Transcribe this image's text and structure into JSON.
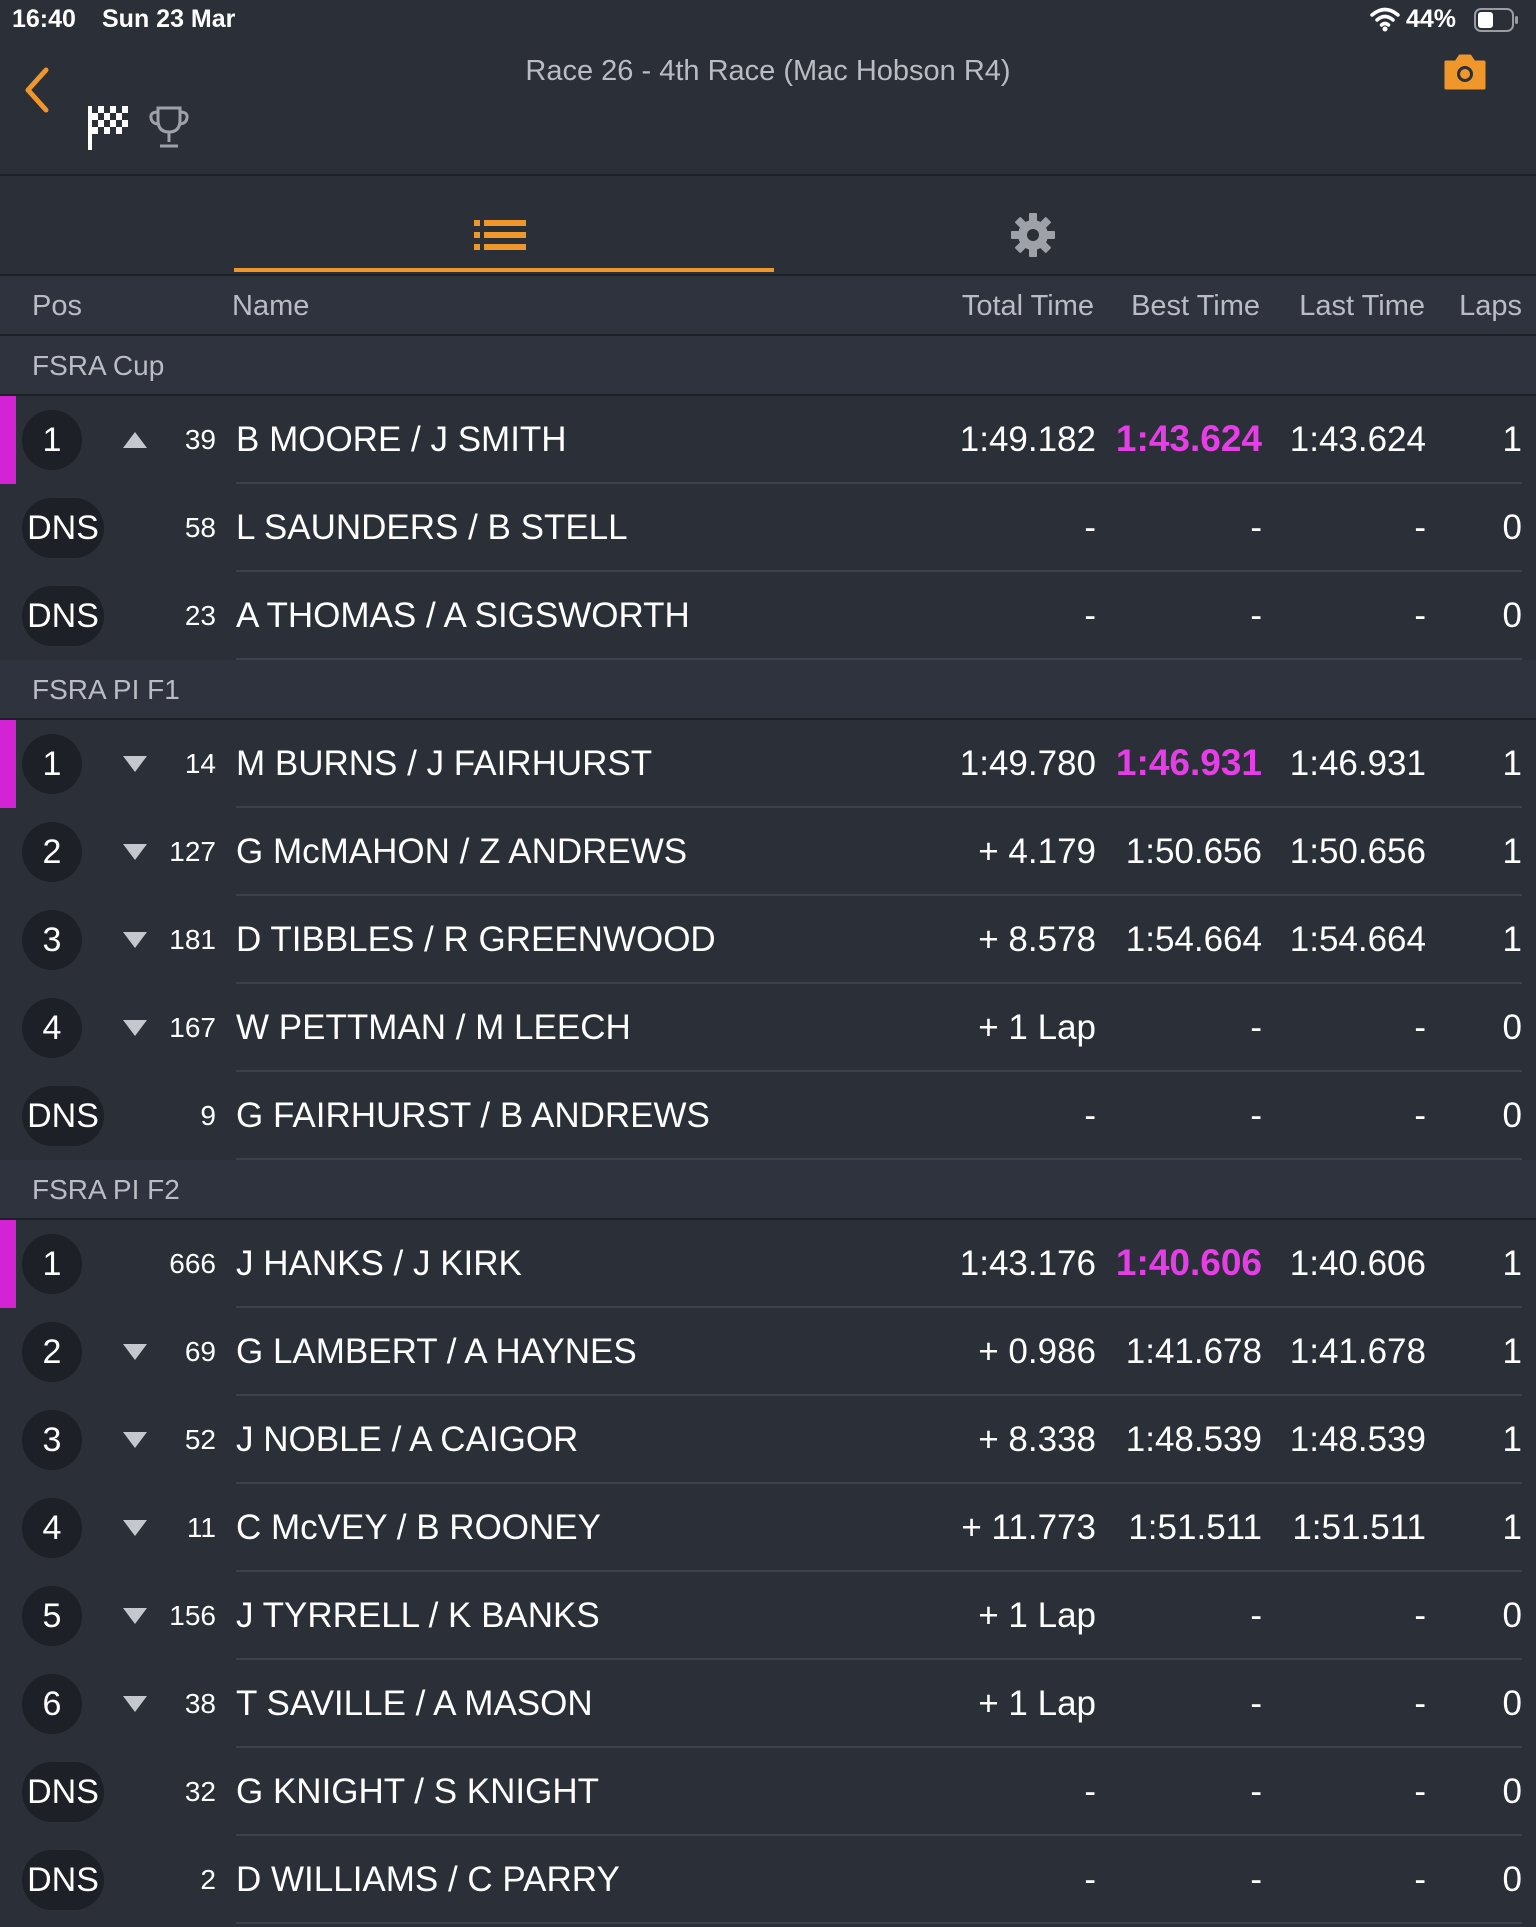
{
  "status_bar": {
    "time": "16:40",
    "date": "Sun 23 Mar",
    "battery": "44%"
  },
  "nav": {
    "title": "Race 26 - 4th Race (Mac Hobson R4)"
  },
  "colors": {
    "accent": "#f0972b",
    "fastest": "#e63ee6",
    "leader": "#d423d4",
    "background": "#2b2f38"
  },
  "icons": [
    "back-chevron-icon",
    "checkered-flag-icon",
    "trophy-icon",
    "camera-icon",
    "list-icon",
    "gear-icon",
    "wifi-icon",
    "battery-icon"
  ],
  "columns": {
    "pos": "Pos",
    "name": "Name",
    "total": "Total Time",
    "best": "Best Time",
    "last": "Last Time",
    "laps": "Laps"
  },
  "sections": [
    {
      "title": "FSRA Cup",
      "rows": [
        {
          "pos": "1",
          "trend": "up",
          "num": "39",
          "name": "B MOORE / J SMITH",
          "total": "1:49.182",
          "best": "1:43.624",
          "best_fastest": true,
          "last": "1:43.624",
          "laps": "1",
          "leader": true
        },
        {
          "pos": "DNS",
          "trend": "",
          "num": "58",
          "name": "L SAUNDERS / B STELL",
          "total": "-",
          "best": "-",
          "last": "-",
          "laps": "0"
        },
        {
          "pos": "DNS",
          "trend": "",
          "num": "23",
          "name": "A THOMAS / A SIGSWORTH",
          "total": "-",
          "best": "-",
          "last": "-",
          "laps": "0"
        }
      ]
    },
    {
      "title": "FSRA PI F1",
      "rows": [
        {
          "pos": "1",
          "trend": "down",
          "num": "14",
          "name": "M BURNS / J FAIRHURST",
          "total": "1:49.780",
          "best": "1:46.931",
          "best_fastest": true,
          "last": "1:46.931",
          "laps": "1",
          "leader": true
        },
        {
          "pos": "2",
          "trend": "down",
          "num": "127",
          "name": "G McMAHON / Z ANDREWS",
          "total": "+ 4.179",
          "best": "1:50.656",
          "last": "1:50.656",
          "laps": "1"
        },
        {
          "pos": "3",
          "trend": "down",
          "num": "181",
          "name": "D TIBBLES / R GREENWOOD",
          "total": "+ 8.578",
          "best": "1:54.664",
          "last": "1:54.664",
          "laps": "1"
        },
        {
          "pos": "4",
          "trend": "down",
          "num": "167",
          "name": "W PETTMAN / M LEECH",
          "total": "+ 1 Lap",
          "best": "-",
          "last": "-",
          "laps": "0"
        },
        {
          "pos": "DNS",
          "trend": "",
          "num": "9",
          "name": "G FAIRHURST / B ANDREWS",
          "total": "-",
          "best": "-",
          "last": "-",
          "laps": "0"
        }
      ]
    },
    {
      "title": "FSRA PI F2",
      "rows": [
        {
          "pos": "1",
          "trend": "",
          "num": "666",
          "name": "J HANKS / J KIRK",
          "total": "1:43.176",
          "best": "1:40.606",
          "best_fastest": true,
          "last": "1:40.606",
          "laps": "1",
          "leader": true
        },
        {
          "pos": "2",
          "trend": "down",
          "num": "69",
          "name": "G LAMBERT / A HAYNES",
          "total": "+ 0.986",
          "best": "1:41.678",
          "last": "1:41.678",
          "laps": "1"
        },
        {
          "pos": "3",
          "trend": "down",
          "num": "52",
          "name": "J NOBLE / A CAIGOR",
          "total": "+ 8.338",
          "best": "1:48.539",
          "last": "1:48.539",
          "laps": "1"
        },
        {
          "pos": "4",
          "trend": "down",
          "num": "11",
          "name": "C McVEY / B ROONEY",
          "total": "+ 11.773",
          "best": "1:51.511",
          "last": "1:51.511",
          "laps": "1"
        },
        {
          "pos": "5",
          "trend": "down",
          "num": "156",
          "name": "J TYRRELL / K BANKS",
          "total": "+ 1 Lap",
          "best": "-",
          "last": "-",
          "laps": "0"
        },
        {
          "pos": "6",
          "trend": "down",
          "num": "38",
          "name": "T SAVILLE / A MASON",
          "total": "+ 1 Lap",
          "best": "-",
          "last": "-",
          "laps": "0"
        },
        {
          "pos": "DNS",
          "trend": "",
          "num": "32",
          "name": "G KNIGHT / S KNIGHT",
          "total": "-",
          "best": "-",
          "last": "-",
          "laps": "0"
        },
        {
          "pos": "DNS",
          "trend": "",
          "num": "2",
          "name": "D WILLIAMS / C PARRY",
          "total": "-",
          "best": "-",
          "last": "-",
          "laps": "0"
        }
      ]
    }
  ]
}
